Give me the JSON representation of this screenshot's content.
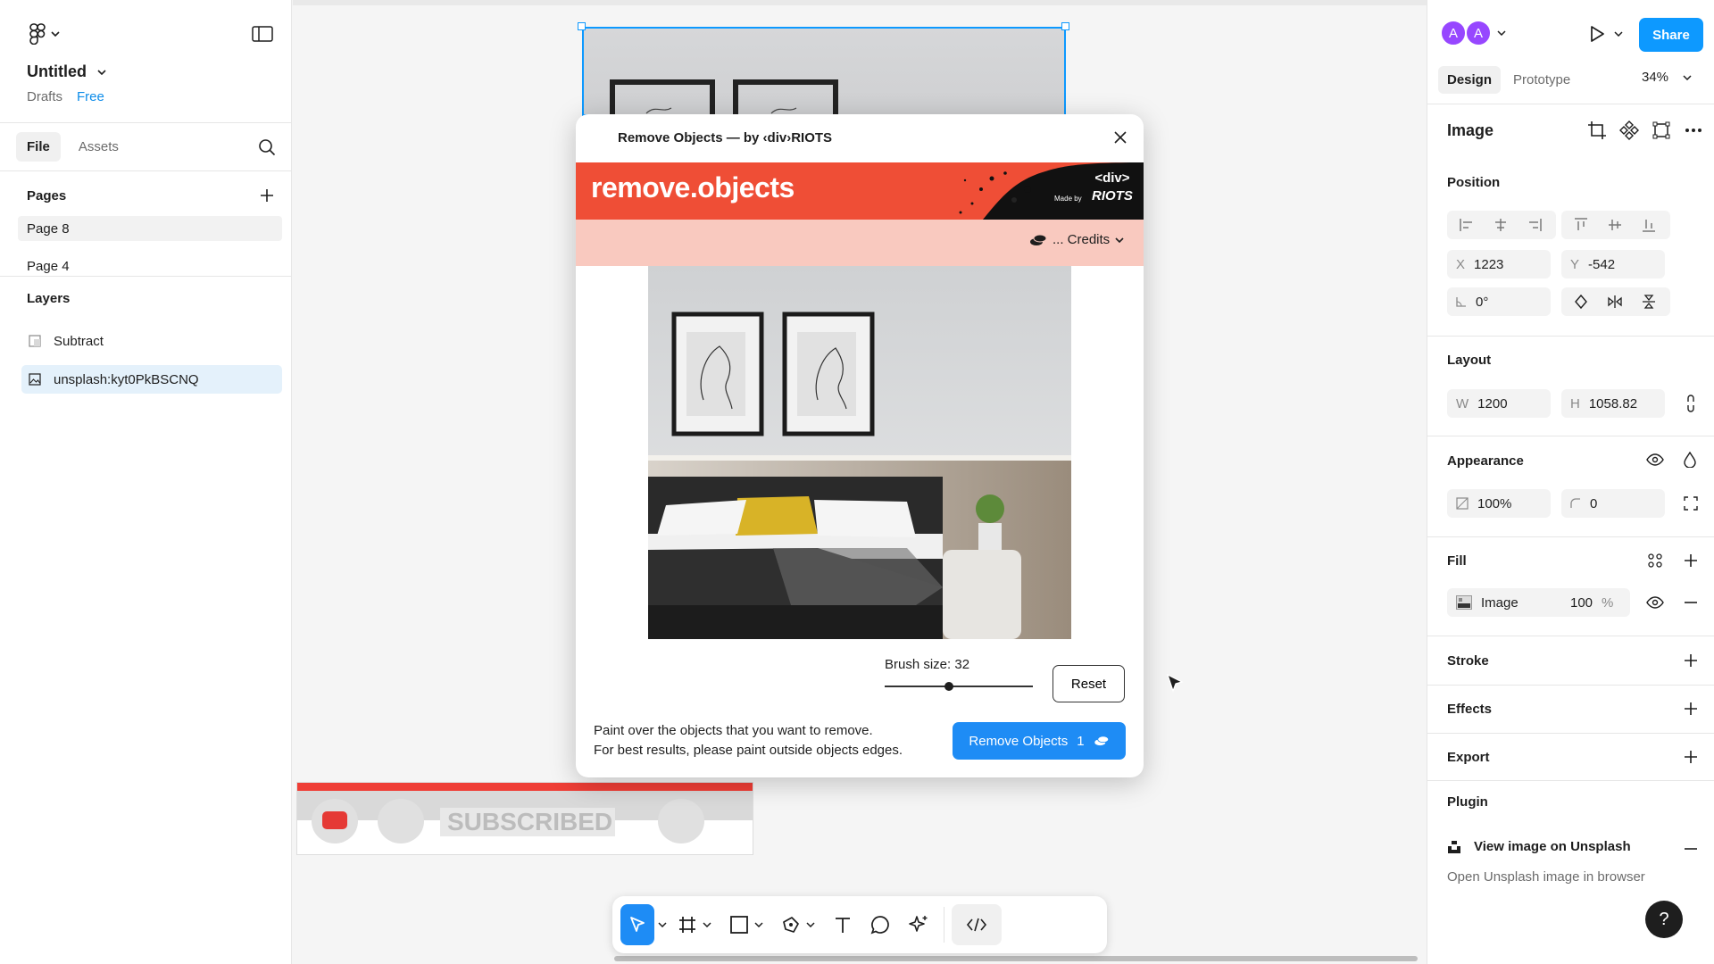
{
  "left": {
    "file_name": "Untitled",
    "drafts": "Drafts",
    "plan": "Free",
    "tabs": [
      "File",
      "Assets"
    ],
    "pages_title": "Pages",
    "pages": [
      "Page 8",
      "Page 4"
    ],
    "layers_title": "Layers",
    "layers": [
      "Subtract",
      "unsplash:kyt0PkBSCNQ"
    ]
  },
  "canvas": {
    "youtube_text": "SUBSCRIBED"
  },
  "modal": {
    "title": "Remove Objects — by ‹div›RIOTS",
    "banner_title": "remove.objects",
    "made_by": "Made by",
    "brand_line1": "<div>",
    "brand_line2": "RIOTS",
    "credits": "... Credits",
    "brush_label": "Brush size: 32",
    "brush_size": 32,
    "reset": "Reset",
    "hint1": "Paint over the objects that you want to remove.",
    "hint2": "For best results, please paint outside objects edges.",
    "remove_label": "Remove Objects",
    "remove_count": "1"
  },
  "right": {
    "avatars": [
      "A",
      "A"
    ],
    "share": "Share",
    "tab_design": "Design",
    "tab_prototype": "Prototype",
    "zoom": "34%",
    "selection_title": "Image",
    "position_title": "Position",
    "x_label": "X",
    "x_value": "1223",
    "y_label": "Y",
    "y_value": "-542",
    "rotation": "0°",
    "layout_title": "Layout",
    "w_label": "W",
    "w_value": "1200",
    "h_label": "H",
    "h_value": "1058.82",
    "appearance_title": "Appearance",
    "opacity": "100%",
    "radius": "0",
    "fill_title": "Fill",
    "fill_type": "Image",
    "fill_opacity": "100",
    "fill_unit": "%",
    "stroke_title": "Stroke",
    "effects_title": "Effects",
    "export_title": "Export",
    "plugin_title": "Plugin",
    "plugin_link": "View image on Unsplash",
    "plugin_sub": "Open Unsplash image in browser",
    "help": "?"
  },
  "colors": {
    "accent": "#0d99ff",
    "brand_red": "#ef4e36",
    "credits_bg": "#f9c9bf",
    "primary_button": "#1e8cf5"
  }
}
